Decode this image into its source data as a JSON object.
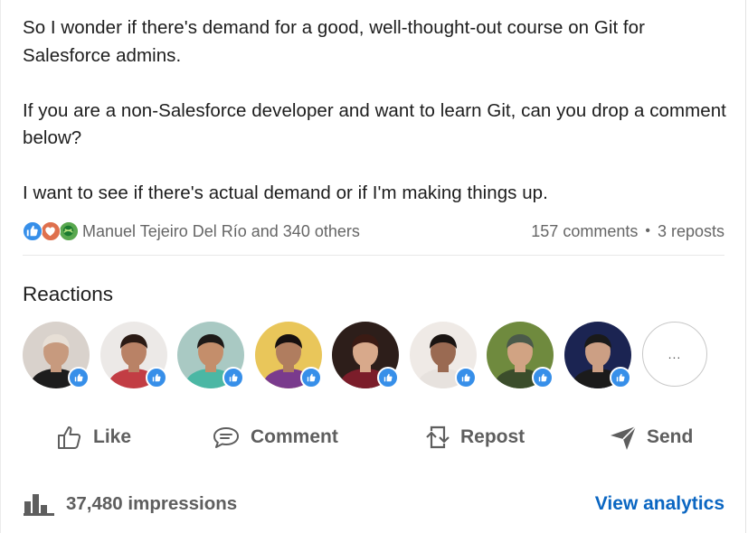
{
  "post": {
    "paragraphs": [
      "So I wonder if there's demand for a good, well-thought-out course on Git for Salesforce admins.",
      "If you are a non-Salesforce developer and want to learn Git, can you drop a comment below?",
      "I want to see if there's actual demand or if I'm making things up."
    ]
  },
  "social": {
    "reaction_icons": [
      "like-icon",
      "love-icon",
      "support-icon"
    ],
    "reactors": "Manuel Tejeiro Del Río and 340 others",
    "comments": "157 comments",
    "separator": "•",
    "reposts": "3 reposts"
  },
  "reactions": {
    "heading": "Reactions",
    "more_label": "...",
    "avatars": [
      {
        "name": "reactor-avatar-1",
        "bg": "#d9d2cc",
        "skin": "#c79a7e",
        "hair": "#e7dfd6",
        "shirt": "#1d1d1d"
      },
      {
        "name": "reactor-avatar-2",
        "bg": "#ece9e7",
        "skin": "#b98266",
        "hair": "#2a1a14",
        "shirt": "#c23d44"
      },
      {
        "name": "reactor-avatar-3",
        "bg": "#a9c9c3",
        "skin": "#c48e6b",
        "hair": "#1e1a18",
        "shirt": "#4bb7a4"
      },
      {
        "name": "reactor-avatar-4",
        "bg": "#e9c65a",
        "skin": "#b07d5f",
        "hair": "#161010",
        "shirt": "#7a3b8d"
      },
      {
        "name": "reactor-avatar-5",
        "bg": "#2d1e1a",
        "skin": "#d8a98b",
        "hair": "#3b1b14",
        "shirt": "#7b1d2a"
      },
      {
        "name": "reactor-avatar-6",
        "bg": "#efeae6",
        "skin": "#9a6a52",
        "hair": "#1a1412",
        "shirt": "#e7e2de"
      },
      {
        "name": "reactor-avatar-7",
        "bg": "#6f8a3e",
        "skin": "#d1a383",
        "hair": "#4b5a4a",
        "shirt": "#3b4d2b"
      },
      {
        "name": "reactor-avatar-8",
        "bg": "#1b2452",
        "skin": "#cc9f84",
        "hair": "#1a1a1a",
        "shirt": "#1b1b1b"
      }
    ]
  },
  "actions": {
    "like": "Like",
    "comment": "Comment",
    "repost": "Repost",
    "send": "Send"
  },
  "analytics": {
    "impressions": "37,480 impressions",
    "view_analytics": "View analytics"
  },
  "colors": {
    "text": "#1d1d1d",
    "muted": "#666666",
    "link": "#0a66c2",
    "like": "#378fe9",
    "love": "#df704d",
    "support": "#59a84f"
  }
}
